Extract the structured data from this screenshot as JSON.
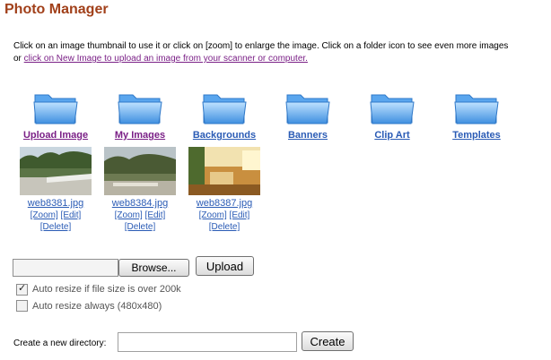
{
  "page": {
    "title": "Photo Manager",
    "instructions_line1": "Click on an image thumbnail to use it or click on [zoom] to enlarge the image. Click on a folder icon to see even more images",
    "instructions_line2_prefix": "or ",
    "instructions_link": "click on New Image to upload an image from your scanner or computer."
  },
  "folders": [
    {
      "label": "Upload Image",
      "icon": "folder-icon"
    },
    {
      "label": "My Images",
      "icon": "folder-icon"
    },
    {
      "label": "Backgrounds",
      "icon": "folder-icon"
    },
    {
      "label": "Banners",
      "icon": "folder-icon"
    },
    {
      "label": "Clip Art",
      "icon": "folder-icon"
    },
    {
      "label": "Templates",
      "icon": "folder-icon"
    }
  ],
  "thumbnails": [
    {
      "file": "web8381.jpg",
      "zoom": "[Zoom]",
      "edit": "[Edit]",
      "delete": "[Delete]"
    },
    {
      "file": "web8384.jpg",
      "zoom": "[Zoom]",
      "edit": "[Edit]",
      "delete": "[Delete]"
    },
    {
      "file": "web8387.jpg",
      "zoom": "[Zoom]",
      "edit": "[Edit]",
      "delete": "[Delete]"
    }
  ],
  "upload": {
    "browse_label": "Browse...",
    "upload_label": "Upload",
    "file_value": ""
  },
  "options": {
    "resize_over_200k_label": "Auto resize if file size is over 200k",
    "resize_over_200k_checked": true,
    "resize_always_label": "Auto resize always (480x480)",
    "resize_always_checked": false
  },
  "directory": {
    "label": "Create a new directory:",
    "value": "",
    "create_label": "Create"
  },
  "colors": {
    "title": "#a1401a",
    "link": "#2a5bb5",
    "visited_link": "#7a1f86"
  }
}
